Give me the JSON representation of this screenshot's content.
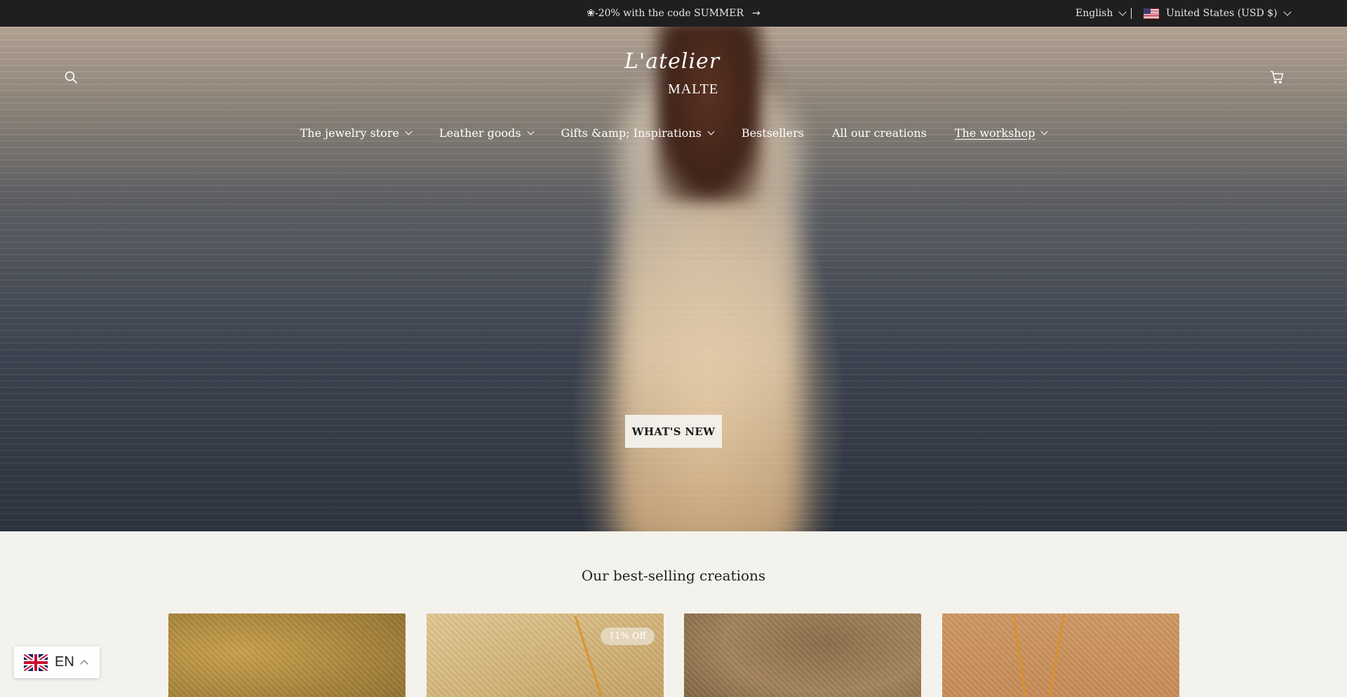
{
  "announcement": {
    "promo_text": "❀-20% with the code SUMMER",
    "language_label": "English",
    "country_label": "United States (USD $)",
    "country_flag": "us-flag"
  },
  "header": {
    "logo_script": "L'atelier",
    "logo_caps": "MALTE",
    "nav": [
      {
        "label": "The jewelry store",
        "has_dropdown": true
      },
      {
        "label": "Leather goods",
        "has_dropdown": true
      },
      {
        "label": "Gifts &amp; Inspirations",
        "has_dropdown": true
      },
      {
        "label": "Bestsellers",
        "has_dropdown": false
      },
      {
        "label": "All our creations",
        "has_dropdown": false
      },
      {
        "label": "The workshop",
        "has_dropdown": true,
        "active": true
      }
    ],
    "icons": {
      "search": "search-icon",
      "cart": "cart-icon"
    }
  },
  "hero": {
    "cta_label": "WHAT'S NEW"
  },
  "best_sellers": {
    "title": "Our best-selling creations",
    "products": [
      {
        "badge": ""
      },
      {
        "badge": "11% Off"
      },
      {
        "badge": ""
      },
      {
        "badge": ""
      }
    ]
  },
  "language_widget": {
    "label": "EN",
    "flag": "uk-flag"
  },
  "colors": {
    "announcement_bg": "#1f1f1f",
    "page_bg": "#f4f2ec",
    "cta_bg": "#f2efe8",
    "text_dark": "#1f1f1f"
  }
}
